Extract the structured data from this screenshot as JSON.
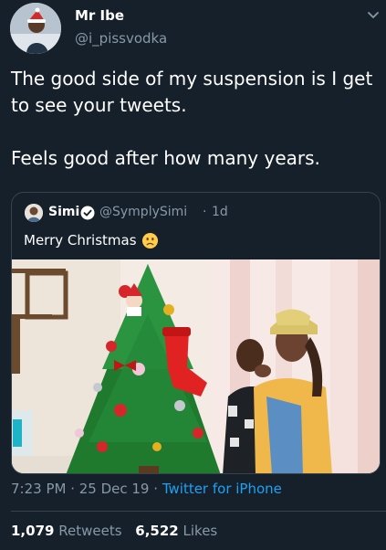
{
  "tweet": {
    "display_name": "Mr Ibe",
    "handle": "@i_pissvodka",
    "text_line_1": "The good side of my suspension is I get to see your tweets.",
    "text_line_2": "Feels good after how many years.",
    "timestamp": "7:23 PM · 25 Dec 19",
    "separator": "·",
    "source": "Twitter for iPhone"
  },
  "quoted": {
    "display_name": "Simi",
    "handle": "@SymplySimi",
    "separator": "·",
    "age": "1d",
    "text": "Merry Christmas",
    "emoji": "slightly-frowning-face"
  },
  "stats": {
    "retweets_count": "1,079",
    "retweets_label": "Retweets",
    "likes_count": "6,522",
    "likes_label": "Likes"
  },
  "colors": {
    "background": "#15202b",
    "primary_text": "#ffffff",
    "secondary_text": "#8899a6",
    "link": "#1da1f2",
    "border": "#38444d"
  }
}
